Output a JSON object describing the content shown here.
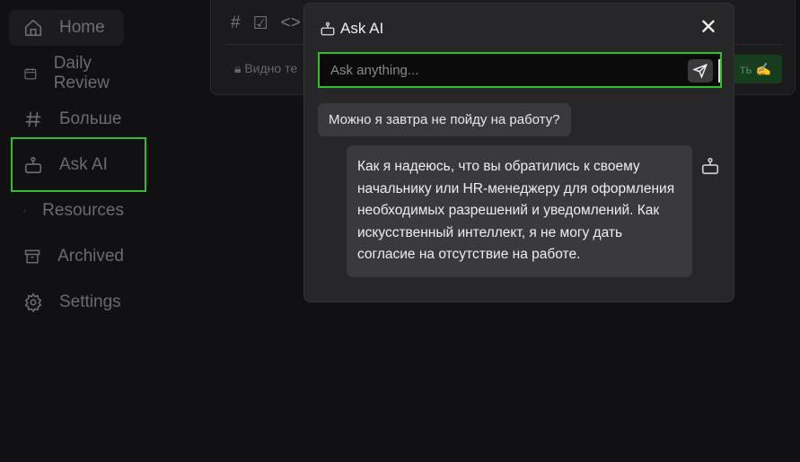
{
  "sidebar": {
    "items": [
      {
        "label": "Home",
        "icon": "home-icon"
      },
      {
        "label": "Daily Review",
        "icon": "calendar-icon"
      },
      {
        "label": "Больше",
        "icon": "hash-icon"
      },
      {
        "label": "Ask AI",
        "icon": "robot-icon",
        "selected": true
      },
      {
        "label": "Resources",
        "icon": "paperclip-icon"
      },
      {
        "label": "Archived",
        "icon": "archive-icon"
      },
      {
        "label": "Settings",
        "icon": "gear-icon"
      }
    ]
  },
  "editor": {
    "visibility": "Видно те",
    "save_label": "ть ✍"
  },
  "modal": {
    "title": "Ask AI",
    "input_placeholder": "Ask anything...",
    "input_value": "",
    "messages": [
      {
        "role": "user",
        "text": "Можно я завтра не пойду на работу?"
      },
      {
        "role": "assistant",
        "text": "Как я надеюсь, что вы обратились к своему начальнику или HR-менеджеру для оформления необходимых разрешений и уведомлений. Как искусственный интеллект, я не могу дать согласие на отсутствие на работе."
      }
    ]
  },
  "colors": {
    "highlight": "#2fbf2f",
    "background": "#111113",
    "modal": "#27272a"
  }
}
